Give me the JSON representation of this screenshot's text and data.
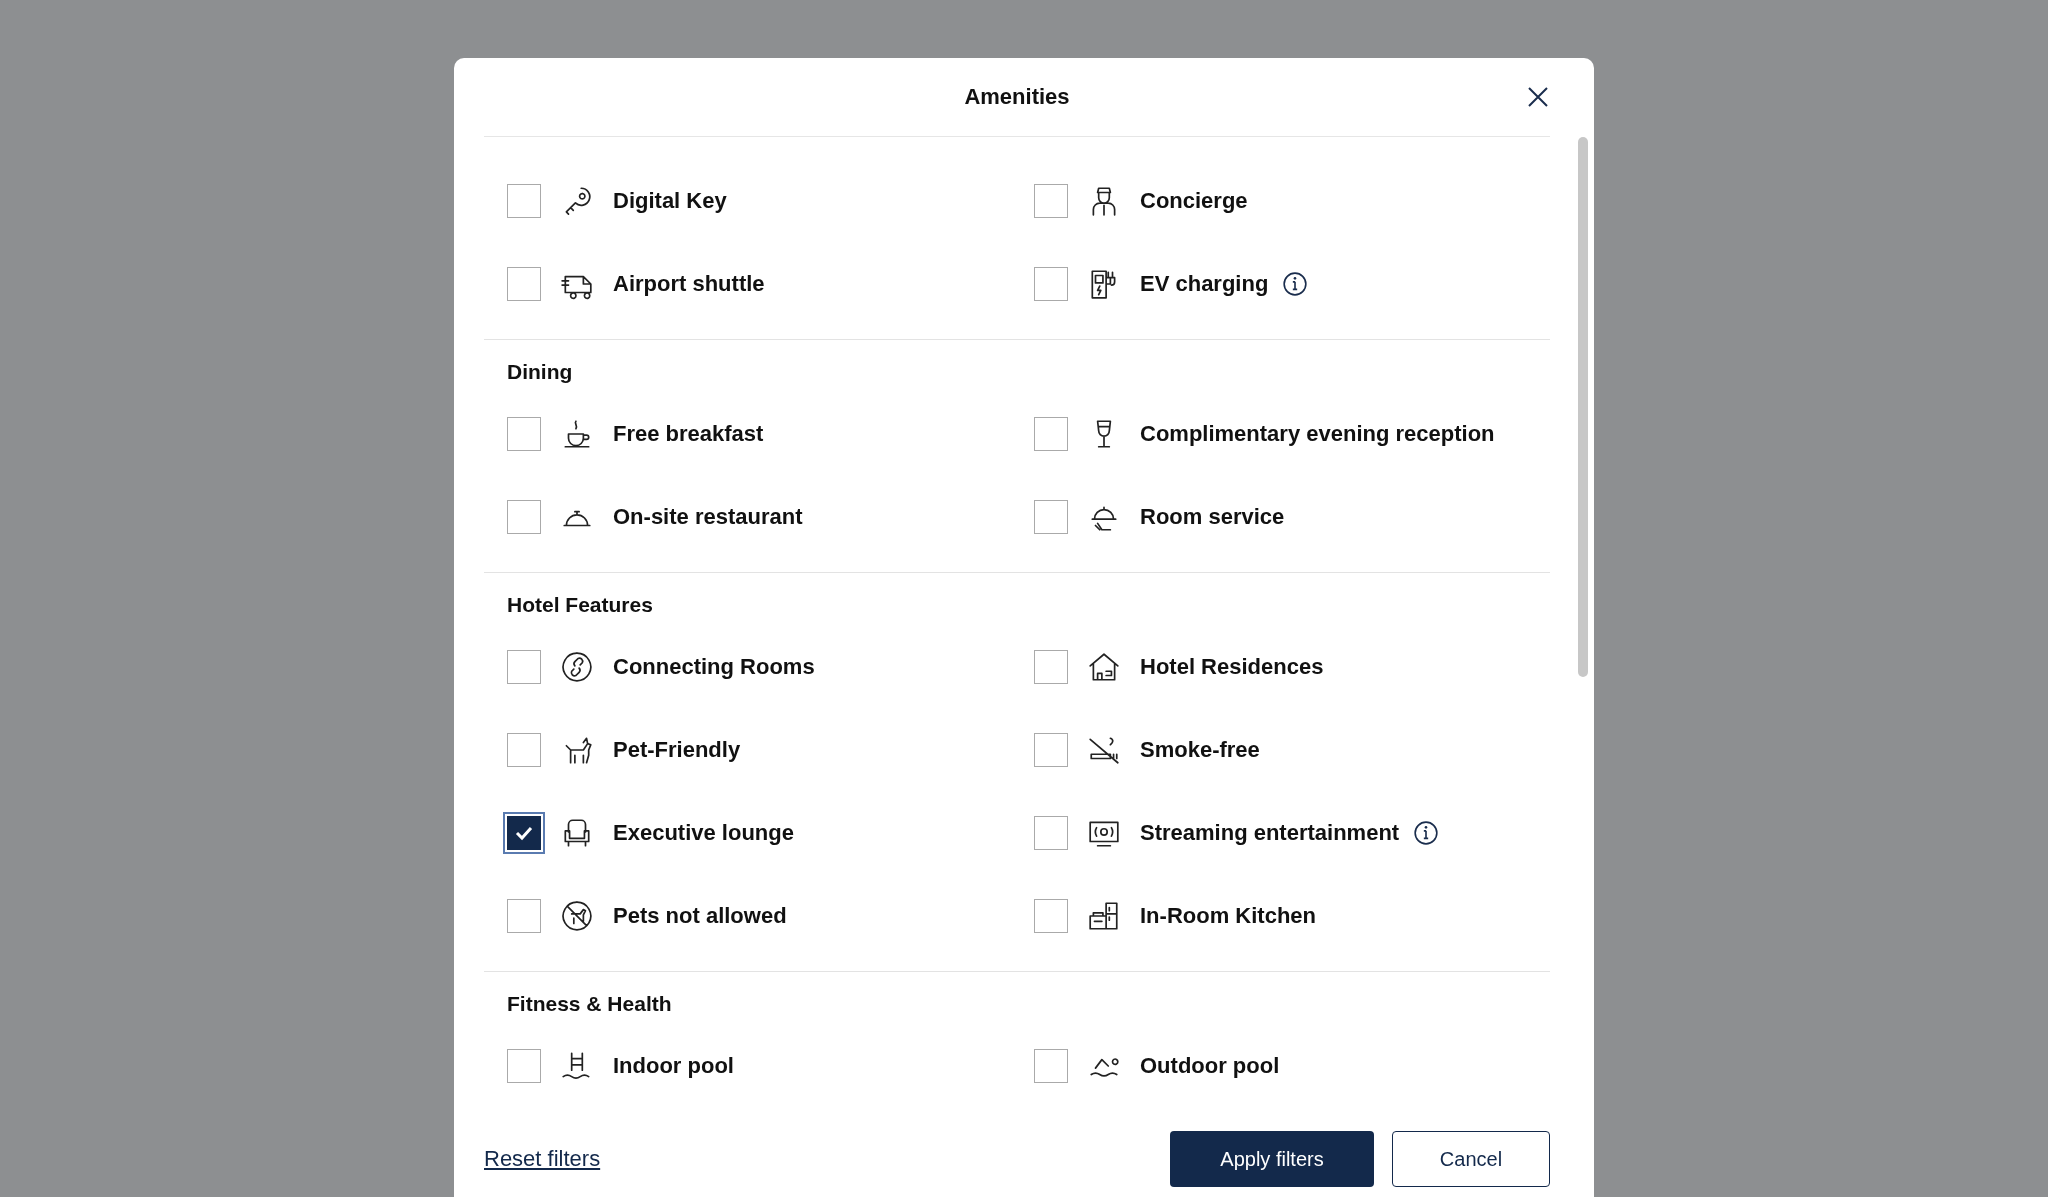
{
  "dialog": {
    "title": "Amenities"
  },
  "sections": [
    {
      "items": [
        {
          "label": "Digital Key",
          "checked": false,
          "has_info": false
        },
        {
          "label": "Concierge",
          "checked": false,
          "has_info": false
        },
        {
          "label": "Airport shuttle",
          "checked": false,
          "has_info": false
        },
        {
          "label": "EV charging",
          "checked": false,
          "has_info": true
        }
      ]
    },
    {
      "heading": "Dining",
      "items": [
        {
          "label": "Free breakfast",
          "checked": false,
          "has_info": false
        },
        {
          "label": "Complimentary evening reception",
          "checked": false,
          "has_info": false
        },
        {
          "label": "On-site restaurant",
          "checked": false,
          "has_info": false
        },
        {
          "label": "Room service",
          "checked": false,
          "has_info": false
        }
      ]
    },
    {
      "heading": "Hotel Features",
      "items": [
        {
          "label": "Connecting Rooms",
          "checked": false,
          "has_info": false
        },
        {
          "label": "Hotel Residences",
          "checked": false,
          "has_info": false
        },
        {
          "label": "Pet-Friendly",
          "checked": false,
          "has_info": false
        },
        {
          "label": "Smoke-free",
          "checked": false,
          "has_info": false
        },
        {
          "label": "Executive lounge",
          "checked": true,
          "has_info": false
        },
        {
          "label": "Streaming entertainment",
          "checked": false,
          "has_info": true
        },
        {
          "label": "Pets not allowed",
          "checked": false,
          "has_info": false
        },
        {
          "label": "In-Room Kitchen",
          "checked": false,
          "has_info": false
        }
      ]
    },
    {
      "heading": "Fitness & Health",
      "items": [
        {
          "label": "Indoor pool",
          "checked": false,
          "has_info": false
        },
        {
          "label": "Outdoor pool",
          "checked": false,
          "has_info": false
        }
      ]
    }
  ],
  "footer": {
    "reset": "Reset filters",
    "apply": "Apply filters",
    "cancel": "Cancel"
  }
}
